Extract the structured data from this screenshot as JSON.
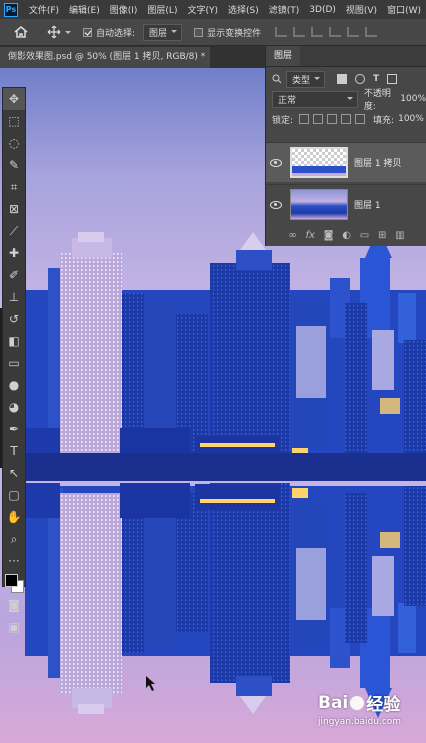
{
  "app": {
    "logo": "Ps"
  },
  "menu": [
    "文件(F)",
    "编辑(E)",
    "图像(I)",
    "图层(L)",
    "文字(Y)",
    "选择(S)",
    "滤镜(T)",
    "3D(D)",
    "视图(V)",
    "窗口(W)"
  ],
  "options": {
    "auto_select_label": "自动选择:",
    "auto_select_value": "图层",
    "show_transform_label": "显示变换控件"
  },
  "document": {
    "tab_title": "倒影效果图.psd @ 50% (图层 1 拷贝, RGB/8) *",
    "close": "×"
  },
  "layers_panel": {
    "tab": "图层",
    "filter_kind": "类型",
    "blend_mode": "正常",
    "opacity_label": "不透明度:",
    "opacity_value": "100%",
    "lock_label": "锁定:",
    "fill_label": "填充:",
    "fill_value": "100%",
    "layers": [
      {
        "name": "图层 1 拷贝",
        "selected": true
      },
      {
        "name": "图层 1",
        "selected": false
      }
    ],
    "footer_icons": [
      "link-icon",
      "fx-icon",
      "mask-icon",
      "adjustment-icon",
      "group-icon",
      "new-layer-icon",
      "trash-icon"
    ]
  },
  "tools": [
    "move-icon",
    "marquee-icon",
    "lasso-icon",
    "quick-select-icon",
    "crop-icon",
    "frame-icon",
    "eyedropper-icon",
    "healing-icon",
    "brush-icon",
    "stamp-icon",
    "history-brush-icon",
    "eraser-icon",
    "gradient-icon",
    "blur-icon",
    "dodge-icon",
    "pen-icon",
    "type-icon",
    "path-select-icon",
    "shape-icon",
    "hand-icon",
    "zoom-icon",
    "more-icon",
    "colors-icon",
    "quickmask-icon",
    "screenmode-icon"
  ],
  "watermark": {
    "brand": "Bai",
    "brand2": "经验",
    "url": "jingyan.baidu.com"
  },
  "colors": {
    "sky_top": "#8a9ad8",
    "sky_mid": "#c6a9d8",
    "city_blue": "#1d3fb0",
    "accent_light": "#ffd36a"
  }
}
